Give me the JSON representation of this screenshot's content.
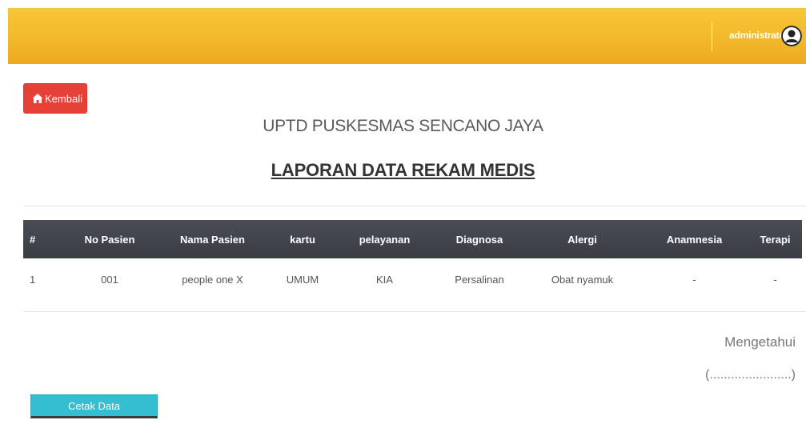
{
  "header": {
    "user_name": "administrator",
    "avatar_icon": "user-avatar-icon"
  },
  "back_button": {
    "label": "Kembali",
    "icon": "home-icon"
  },
  "report": {
    "org_name": "UPTD PUSKESMAS SENCANO JAYA",
    "title": "LAPORAN DATA REKAM MEDIS"
  },
  "table": {
    "columns": [
      "#",
      "No Pasien",
      "Nama Pasien",
      "kartu",
      "pelayanan",
      "Diagnosa",
      "Alergi",
      "Anamnesia",
      "Terapi"
    ],
    "rows": [
      [
        "1",
        "001",
        "people one X",
        "UMUM",
        "KIA",
        "Persalinan",
        "Obat nyamuk",
        "-",
        "-"
      ]
    ]
  },
  "footer": {
    "acknowledge": "Mengetahui",
    "signature_placeholder": "(.......................)",
    "print_button": "Cetak Data"
  },
  "colors": {
    "topbar": "#f2b72a",
    "back_button": "#e64137",
    "table_header": "#43454d",
    "print_button": "#35bdd0"
  }
}
